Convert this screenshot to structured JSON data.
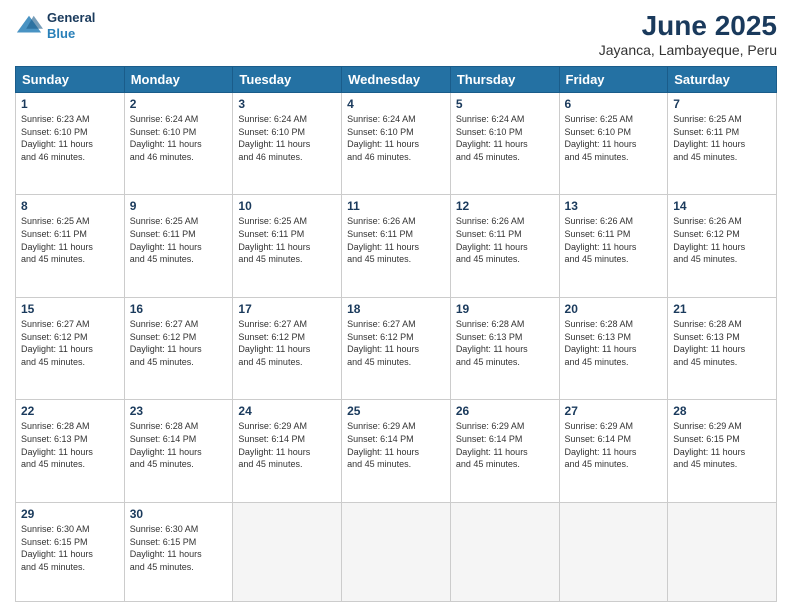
{
  "header": {
    "logo_line1": "General",
    "logo_line2": "Blue",
    "title": "June 2025",
    "subtitle": "Jayanca, Lambayeque, Peru"
  },
  "days_of_week": [
    "Sunday",
    "Monday",
    "Tuesday",
    "Wednesday",
    "Thursday",
    "Friday",
    "Saturday"
  ],
  "weeks": [
    [
      {
        "day": "1",
        "info": "Sunrise: 6:23 AM\nSunset: 6:10 PM\nDaylight: 11 hours\nand 46 minutes."
      },
      {
        "day": "2",
        "info": "Sunrise: 6:24 AM\nSunset: 6:10 PM\nDaylight: 11 hours\nand 46 minutes."
      },
      {
        "day": "3",
        "info": "Sunrise: 6:24 AM\nSunset: 6:10 PM\nDaylight: 11 hours\nand 46 minutes."
      },
      {
        "day": "4",
        "info": "Sunrise: 6:24 AM\nSunset: 6:10 PM\nDaylight: 11 hours\nand 46 minutes."
      },
      {
        "day": "5",
        "info": "Sunrise: 6:24 AM\nSunset: 6:10 PM\nDaylight: 11 hours\nand 45 minutes."
      },
      {
        "day": "6",
        "info": "Sunrise: 6:25 AM\nSunset: 6:10 PM\nDaylight: 11 hours\nand 45 minutes."
      },
      {
        "day": "7",
        "info": "Sunrise: 6:25 AM\nSunset: 6:11 PM\nDaylight: 11 hours\nand 45 minutes."
      }
    ],
    [
      {
        "day": "8",
        "info": "Sunrise: 6:25 AM\nSunset: 6:11 PM\nDaylight: 11 hours\nand 45 minutes."
      },
      {
        "day": "9",
        "info": "Sunrise: 6:25 AM\nSunset: 6:11 PM\nDaylight: 11 hours\nand 45 minutes."
      },
      {
        "day": "10",
        "info": "Sunrise: 6:25 AM\nSunset: 6:11 PM\nDaylight: 11 hours\nand 45 minutes."
      },
      {
        "day": "11",
        "info": "Sunrise: 6:26 AM\nSunset: 6:11 PM\nDaylight: 11 hours\nand 45 minutes."
      },
      {
        "day": "12",
        "info": "Sunrise: 6:26 AM\nSunset: 6:11 PM\nDaylight: 11 hours\nand 45 minutes."
      },
      {
        "day": "13",
        "info": "Sunrise: 6:26 AM\nSunset: 6:11 PM\nDaylight: 11 hours\nand 45 minutes."
      },
      {
        "day": "14",
        "info": "Sunrise: 6:26 AM\nSunset: 6:12 PM\nDaylight: 11 hours\nand 45 minutes."
      }
    ],
    [
      {
        "day": "15",
        "info": "Sunrise: 6:27 AM\nSunset: 6:12 PM\nDaylight: 11 hours\nand 45 minutes."
      },
      {
        "day": "16",
        "info": "Sunrise: 6:27 AM\nSunset: 6:12 PM\nDaylight: 11 hours\nand 45 minutes."
      },
      {
        "day": "17",
        "info": "Sunrise: 6:27 AM\nSunset: 6:12 PM\nDaylight: 11 hours\nand 45 minutes."
      },
      {
        "day": "18",
        "info": "Sunrise: 6:27 AM\nSunset: 6:12 PM\nDaylight: 11 hours\nand 45 minutes."
      },
      {
        "day": "19",
        "info": "Sunrise: 6:28 AM\nSunset: 6:13 PM\nDaylight: 11 hours\nand 45 minutes."
      },
      {
        "day": "20",
        "info": "Sunrise: 6:28 AM\nSunset: 6:13 PM\nDaylight: 11 hours\nand 45 minutes."
      },
      {
        "day": "21",
        "info": "Sunrise: 6:28 AM\nSunset: 6:13 PM\nDaylight: 11 hours\nand 45 minutes."
      }
    ],
    [
      {
        "day": "22",
        "info": "Sunrise: 6:28 AM\nSunset: 6:13 PM\nDaylight: 11 hours\nand 45 minutes."
      },
      {
        "day": "23",
        "info": "Sunrise: 6:28 AM\nSunset: 6:14 PM\nDaylight: 11 hours\nand 45 minutes."
      },
      {
        "day": "24",
        "info": "Sunrise: 6:29 AM\nSunset: 6:14 PM\nDaylight: 11 hours\nand 45 minutes."
      },
      {
        "day": "25",
        "info": "Sunrise: 6:29 AM\nSunset: 6:14 PM\nDaylight: 11 hours\nand 45 minutes."
      },
      {
        "day": "26",
        "info": "Sunrise: 6:29 AM\nSunset: 6:14 PM\nDaylight: 11 hours\nand 45 minutes."
      },
      {
        "day": "27",
        "info": "Sunrise: 6:29 AM\nSunset: 6:14 PM\nDaylight: 11 hours\nand 45 minutes."
      },
      {
        "day": "28",
        "info": "Sunrise: 6:29 AM\nSunset: 6:15 PM\nDaylight: 11 hours\nand 45 minutes."
      }
    ],
    [
      {
        "day": "29",
        "info": "Sunrise: 6:30 AM\nSunset: 6:15 PM\nDaylight: 11 hours\nand 45 minutes."
      },
      {
        "day": "30",
        "info": "Sunrise: 6:30 AM\nSunset: 6:15 PM\nDaylight: 11 hours\nand 45 minutes."
      },
      {
        "day": "",
        "info": ""
      },
      {
        "day": "",
        "info": ""
      },
      {
        "day": "",
        "info": ""
      },
      {
        "day": "",
        "info": ""
      },
      {
        "day": "",
        "info": ""
      }
    ]
  ]
}
